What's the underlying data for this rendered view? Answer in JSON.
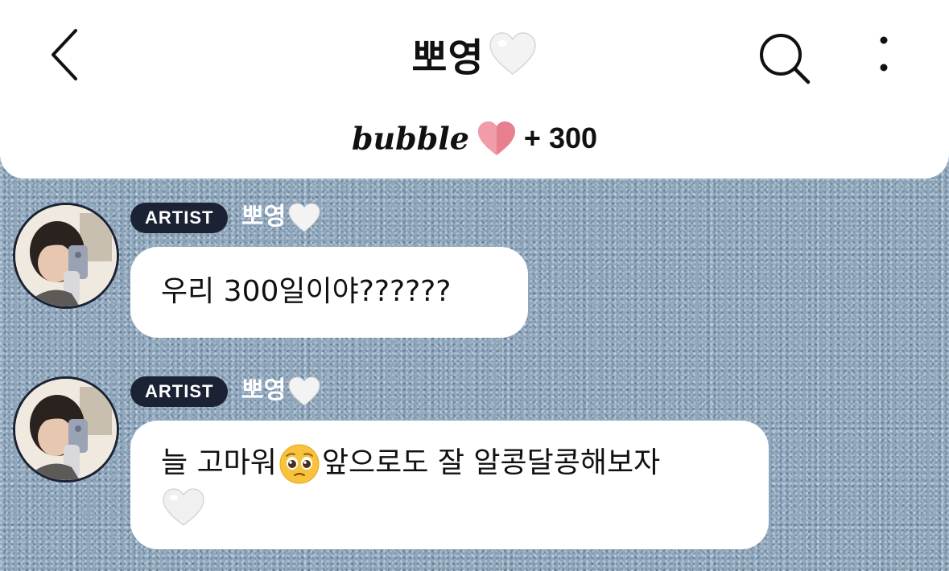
{
  "header": {
    "title": "뽀영",
    "bubble_word": "bubble",
    "bubble_count": "+ 300"
  },
  "messages": [
    {
      "badge": "ARTIST",
      "sender": "뽀영",
      "text": "우리 300일이야??????"
    },
    {
      "badge": "ARTIST",
      "sender": "뽀영",
      "text_before_emoji": "늘 고마워",
      "text_after_emoji": "앞으로도 잘 알콩달콩해보자"
    }
  ],
  "icons": {
    "back": "back-chevron-icon",
    "search": "search-icon",
    "more": "more-vertical-icon",
    "title_heart": "white-heart-icon",
    "bubble_heart": "pink-heart-icon",
    "pleading_face": "pleading-face-emoji"
  },
  "colors": {
    "badge_bg": "#1b2233",
    "bubble_heart": "#e87f8f",
    "bubble_bg": "#ffffff"
  }
}
